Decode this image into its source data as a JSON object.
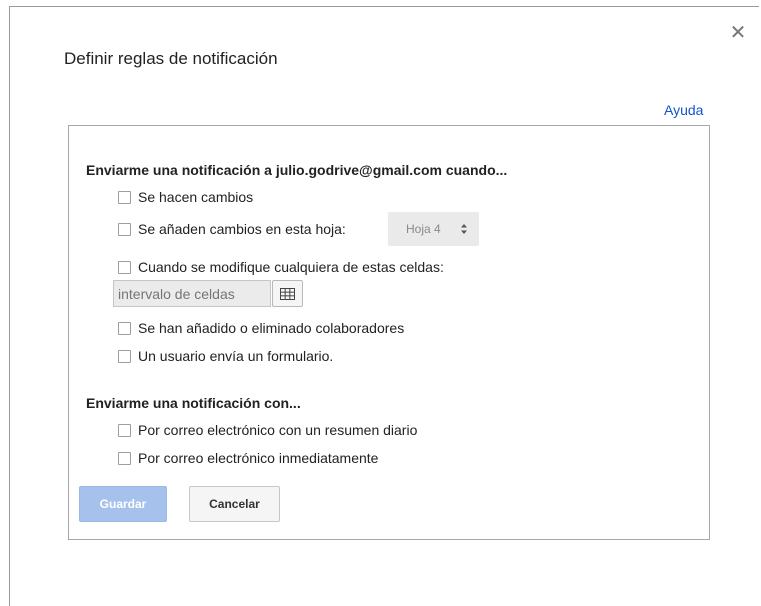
{
  "dialog": {
    "title": "Definir reglas de notificación",
    "close_icon": "close-icon",
    "help_label": "Ayuda"
  },
  "when_section": {
    "heading": "Enviarme una notificación a julio.godrive@gmail.com cuando...",
    "options": [
      {
        "label": "Se hacen cambios",
        "checked": false
      },
      {
        "label": "Se añaden cambios en esta hoja:",
        "checked": false
      },
      {
        "label": "Cuando se modifique cualquiera de estas celdas:",
        "checked": false
      },
      {
        "label": "Se han añadido o eliminado colaboradores",
        "checked": false
      },
      {
        "label": "Un usuario envía un formulario.",
        "checked": false
      }
    ],
    "sheet_select": {
      "value": "Hoja 4",
      "icon": "up-down-arrows-icon"
    },
    "range_input": {
      "placeholder": "intervalo de celdas",
      "value": ""
    },
    "grid_button_icon": "grid-icon"
  },
  "how_section": {
    "heading": "Enviarme una notificación con...",
    "options": [
      {
        "label": "Por correo electrónico con un resumen diario",
        "checked": false
      },
      {
        "label": "Por correo electrónico inmediatamente",
        "checked": false
      }
    ]
  },
  "buttons": {
    "save_label": "Guardar",
    "cancel_label": "Cancelar"
  },
  "colors": {
    "link": "#1155cc",
    "save_button_disabled": "#a6c2ec",
    "border": "#a8a8a8"
  }
}
